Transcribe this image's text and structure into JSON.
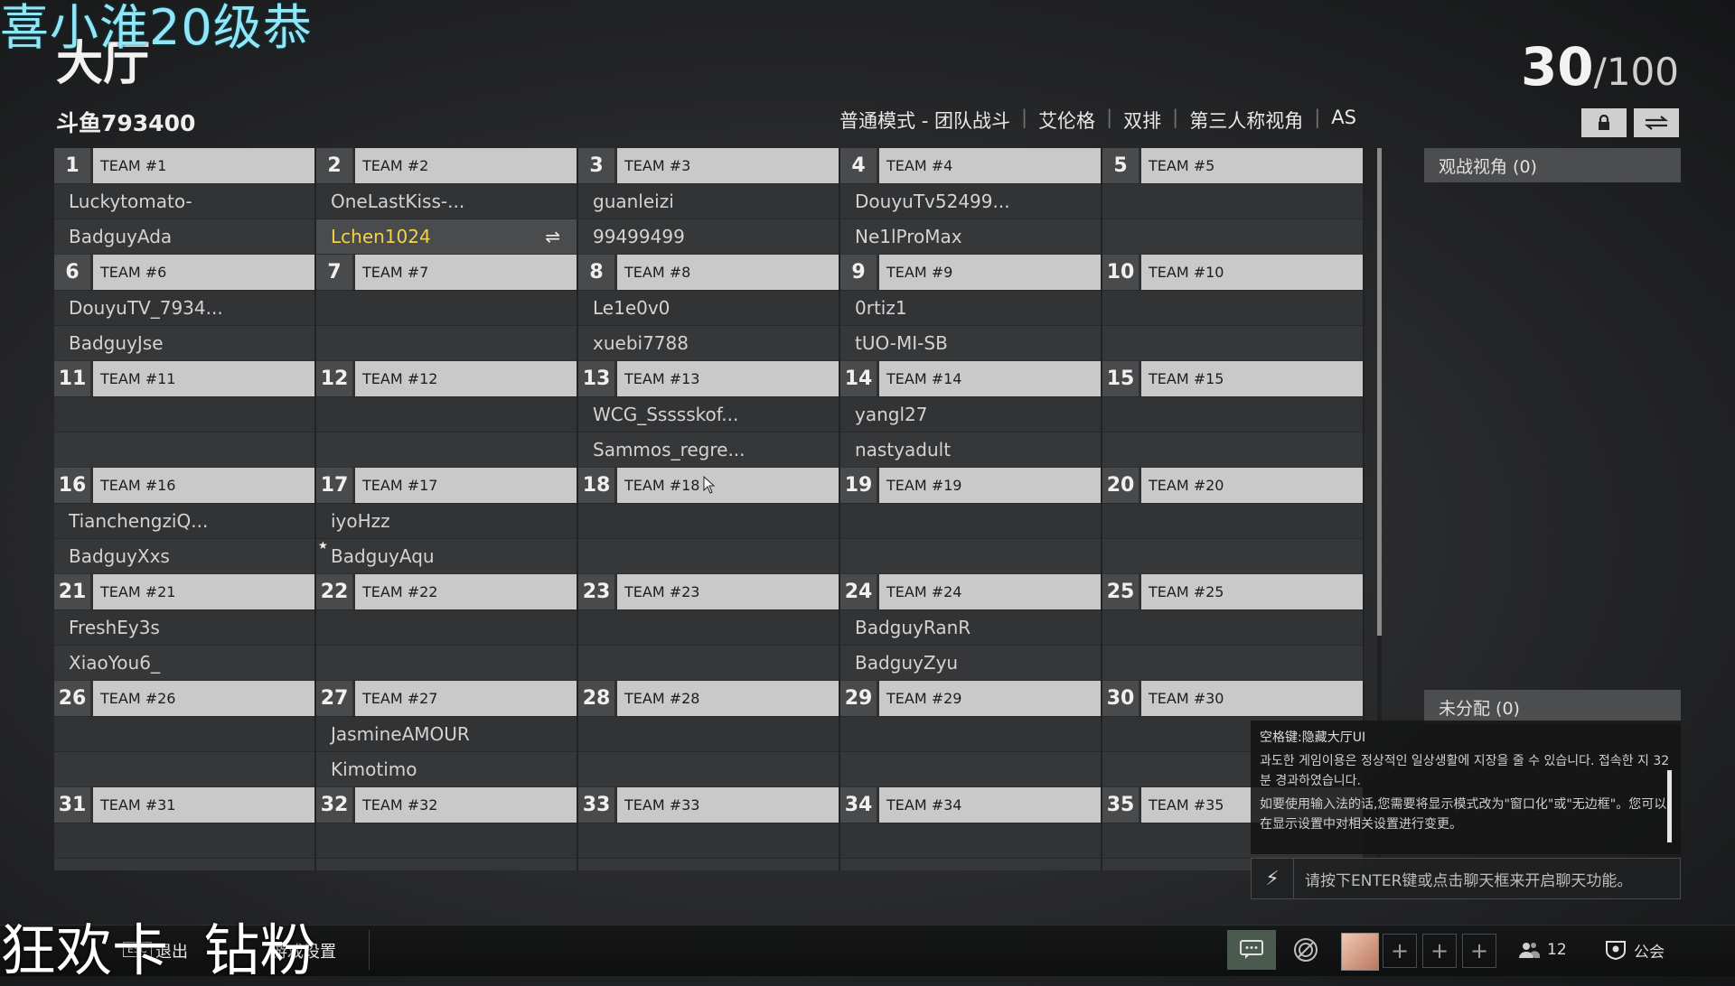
{
  "overlay": {
    "top_text": "喜小淮20级恭",
    "bottom_text": "狂欢卡  钻粉"
  },
  "header": {
    "title": "大厅",
    "count_current": "30",
    "count_sep": "/",
    "count_max": "100",
    "lobby_id": "斗鱼793400",
    "mode": [
      "普通模式 - 团队战斗",
      "艾伦格",
      "双排",
      "第三人称视角",
      "AS"
    ]
  },
  "teams": [
    {
      "num": "1",
      "label": "TEAM #1",
      "p1": "Luckytomato-",
      "p2": "BadguyAda"
    },
    {
      "num": "2",
      "label": "TEAM #2",
      "p1": "OneLastKiss-...",
      "p2": "Lchen1024"
    },
    {
      "num": "3",
      "label": "TEAM #3",
      "p1": "guanleizi",
      "p2": "99499499"
    },
    {
      "num": "4",
      "label": "TEAM #4",
      "p1": "DouyuTv52499...",
      "p2": "Ne1lProMax"
    },
    {
      "num": "5",
      "label": "TEAM #5",
      "p1": "",
      "p2": ""
    },
    {
      "num": "6",
      "label": "TEAM #6",
      "p1": "DouyuTV_7934...",
      "p2": "BadguyJse"
    },
    {
      "num": "7",
      "label": "TEAM #7",
      "p1": "",
      "p2": ""
    },
    {
      "num": "8",
      "label": "TEAM #8",
      "p1": "Le1e0v0",
      "p2": "xuebi7788"
    },
    {
      "num": "9",
      "label": "TEAM #9",
      "p1": "0rtiz1",
      "p2": "tUO-MI-SB"
    },
    {
      "num": "10",
      "label": "TEAM #10",
      "p1": "",
      "p2": ""
    },
    {
      "num": "11",
      "label": "TEAM #11",
      "p1": "",
      "p2": ""
    },
    {
      "num": "12",
      "label": "TEAM #12",
      "p1": "",
      "p2": ""
    },
    {
      "num": "13",
      "label": "TEAM #13",
      "p1": "WCG_Ssssskof...",
      "p2": "Sammos_regre..."
    },
    {
      "num": "14",
      "label": "TEAM #14",
      "p1": "yangl27",
      "p2": "nastyadult"
    },
    {
      "num": "15",
      "label": "TEAM #15",
      "p1": "",
      "p2": ""
    },
    {
      "num": "16",
      "label": "TEAM #16",
      "p1": "TianchengziQ...",
      "p2": "BadguyXxs"
    },
    {
      "num": "17",
      "label": "TEAM #17",
      "p1": "iyoHzz",
      "p2": "BadguyAqu"
    },
    {
      "num": "18",
      "label": "TEAM #18",
      "p1": "",
      "p2": ""
    },
    {
      "num": "19",
      "label": "TEAM #19",
      "p1": "",
      "p2": ""
    },
    {
      "num": "20",
      "label": "TEAM #20",
      "p1": "",
      "p2": ""
    },
    {
      "num": "21",
      "label": "TEAM #21",
      "p1": "FreshEy3s",
      "p2": "XiaoYou6_"
    },
    {
      "num": "22",
      "label": "TEAM #22",
      "p1": "",
      "p2": ""
    },
    {
      "num": "23",
      "label": "TEAM #23",
      "p1": "",
      "p2": ""
    },
    {
      "num": "24",
      "label": "TEAM #24",
      "p1": "BadguyRanR",
      "p2": "BadguyZyu"
    },
    {
      "num": "25",
      "label": "TEAM #25",
      "p1": "",
      "p2": ""
    },
    {
      "num": "26",
      "label": "TEAM #26",
      "p1": "",
      "p2": ""
    },
    {
      "num": "27",
      "label": "TEAM #27",
      "p1": "JasmineAMOUR",
      "p2": "Kimotimo"
    },
    {
      "num": "28",
      "label": "TEAM #28",
      "p1": "",
      "p2": ""
    },
    {
      "num": "29",
      "label": "TEAM #29",
      "p1": "",
      "p2": ""
    },
    {
      "num": "30",
      "label": "TEAM #30",
      "p1": "",
      "p2": ""
    },
    {
      "num": "31",
      "label": "TEAM #31",
      "p1": "",
      "p2": ""
    },
    {
      "num": "32",
      "label": "TEAM #32",
      "p1": "",
      "p2": ""
    },
    {
      "num": "33",
      "label": "TEAM #33",
      "p1": "",
      "p2": ""
    },
    {
      "num": "34",
      "label": "TEAM #34",
      "p1": "",
      "p2": ""
    },
    {
      "num": "35",
      "label": "TEAM #35",
      "p1": "",
      "p2": ""
    }
  ],
  "spectator": {
    "label": "观战视角 (0)"
  },
  "unassigned": {
    "label": "未分配 (0)"
  },
  "chat": {
    "messages": [
      "空格键:隐藏大厅UI",
      "과도한 게임이용은 정상적인 일상생활에 지장을 줄 수 있습니다. 접속한 지 32분 경과하였습니다.",
      "如要使用输入法的话,您需要将显示模式改为\"窗口化\"或\"无边框\"。您可以在显示设置中对相关设置进行变更。"
    ],
    "placeholder": "请按下ENTER键或点击聊天框来开启聊天功能。"
  },
  "bottom": {
    "esc_key": "ESC",
    "exit": "退出",
    "settings": "游戏设置",
    "friends_count": "12",
    "guild": "公会"
  },
  "icons": {
    "lock": "lock-icon",
    "swap": "swap-icon",
    "bolt": "lightning-icon",
    "chat": "chat-bubble-icon",
    "friends": "friends-icon",
    "guild": "guild-icon"
  }
}
